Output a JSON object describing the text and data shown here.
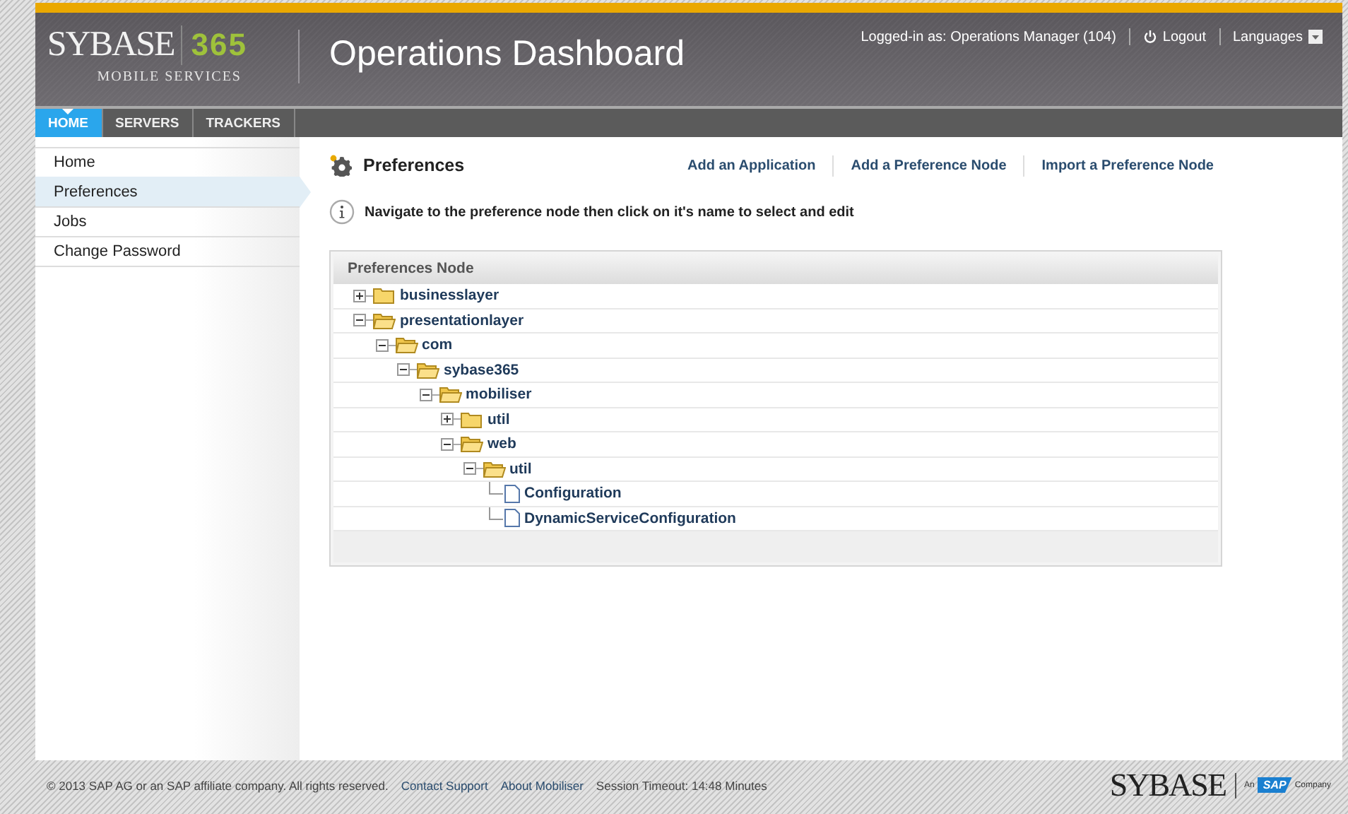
{
  "header": {
    "logo": {
      "brand": "SYBASE",
      "product": "365",
      "subtitle": "MOBILE SERVICES"
    },
    "title": "Operations Dashboard",
    "user": "Logged-in as: Operations Manager (104)",
    "logout": "Logout",
    "languages": "Languages"
  },
  "tabs": [
    {
      "label": "HOME",
      "selected": true
    },
    {
      "label": "SERVERS",
      "selected": false
    },
    {
      "label": "TRACKERS",
      "selected": false
    }
  ],
  "sidebar": {
    "items": [
      {
        "label": "Home",
        "selected": false
      },
      {
        "label": "Preferences",
        "selected": true
      },
      {
        "label": "Jobs",
        "selected": false
      },
      {
        "label": "Change Password",
        "selected": false
      }
    ]
  },
  "page": {
    "heading": "Preferences",
    "actions": [
      "Add an Application",
      "Add a Preference Node",
      "Import a Preference Node"
    ],
    "info": "Navigate to the preference node then click on it's name to select and edit"
  },
  "tree": {
    "header": "Preferences Node",
    "nodes": [
      {
        "label": "businesslayer",
        "kind": "folder",
        "expanded": false
      },
      {
        "label": "presentationlayer",
        "kind": "folder",
        "expanded": true,
        "children": [
          {
            "label": "com",
            "kind": "folder",
            "expanded": true,
            "children": [
              {
                "label": "sybase365",
                "kind": "folder",
                "expanded": true,
                "children": [
                  {
                    "label": "mobiliser",
                    "kind": "folder",
                    "expanded": true,
                    "children": [
                      {
                        "label": "util",
                        "kind": "folder",
                        "expanded": false
                      },
                      {
                        "label": "web",
                        "kind": "folder",
                        "expanded": true,
                        "children": [
                          {
                            "label": "util",
                            "kind": "folder",
                            "expanded": true,
                            "children": [
                              {
                                "label": "Configuration",
                                "kind": "file"
                              },
                              {
                                "label": "DynamicServiceConfiguration",
                                "kind": "file"
                              }
                            ]
                          }
                        ]
                      }
                    ]
                  }
                ]
              }
            ]
          }
        ]
      }
    ]
  },
  "footer": {
    "copyright": "© 2013 SAP AG or an SAP affiliate company. All rights reserved.",
    "links": [
      "Contact Support",
      "About Mobiliser"
    ],
    "session": "Session Timeout: 14:48 Minutes",
    "brand": "SYBASE",
    "sap": {
      "prefix": "An",
      "badge": "SAP",
      "suffix": "Company"
    }
  }
}
